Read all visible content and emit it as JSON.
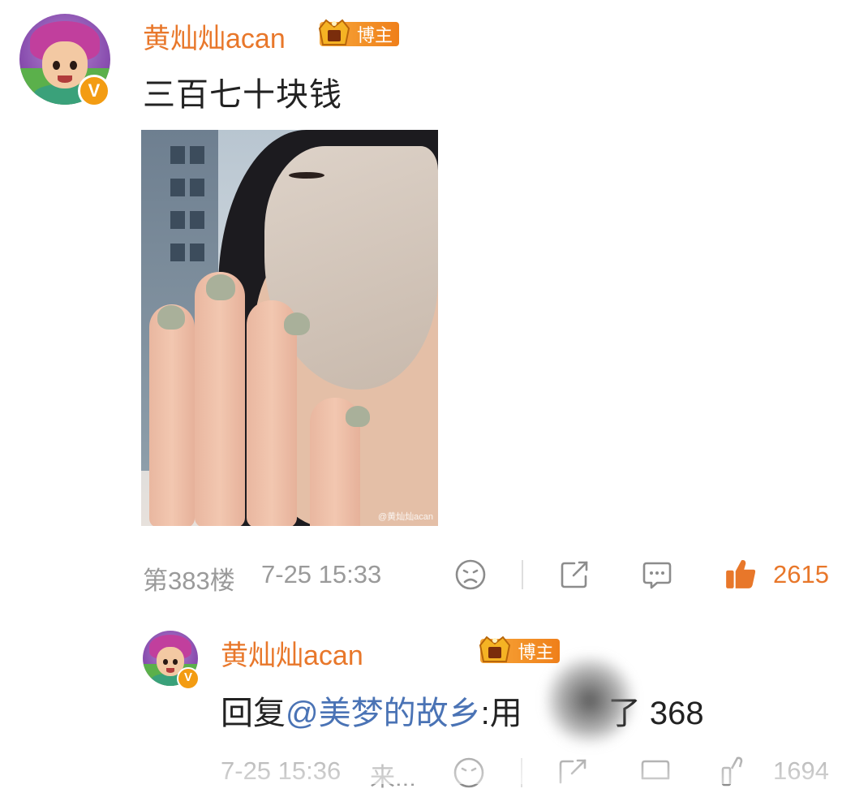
{
  "post": {
    "username": "黄灿灿acan",
    "badge_label": "博主",
    "verified_mark": "V",
    "text": "三百七十块钱",
    "image_watermark": "@黄灿灿acan",
    "floor": "第383楼",
    "time": "7-25 15:33",
    "likes": "2615",
    "icons": [
      "dislike-face-icon",
      "share-icon",
      "comment-icon",
      "like-thumb-icon"
    ]
  },
  "reply": {
    "username": "黄灿灿acan",
    "badge_label": "博主",
    "verified_mark": "V",
    "prefix": "回复",
    "mention": "@美梦的故乡",
    "colon_text": ":用",
    "suffix": "了 368",
    "time": "7-25 15:36",
    "source": "来...",
    "likes": "1694"
  },
  "colors": {
    "accent": "#e8772a",
    "mention": "#4a73b5",
    "meta": "#9a9a9a"
  }
}
